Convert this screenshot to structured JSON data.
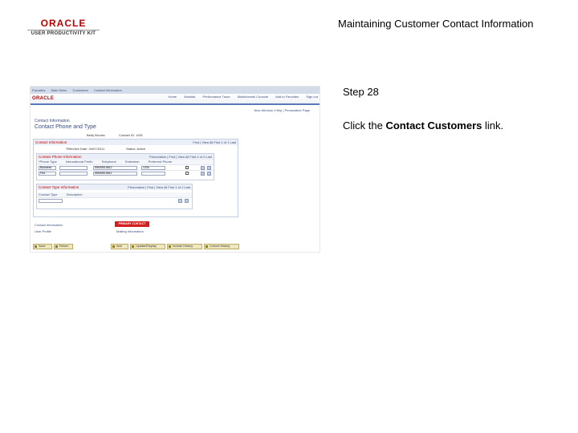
{
  "header": {
    "brand": "ORACLE",
    "brand_sub": "USER PRODUCTIVITY KIT",
    "title": "Maintaining Customer Contact Information"
  },
  "step": {
    "label": "Step 28",
    "instruction_prefix": "Click the ",
    "instruction_link": "Contact Customers",
    "instruction_suffix": " link."
  },
  "app": {
    "breadcrumbs": [
      "Favorites",
      "Main Menu",
      "Customers",
      "Contact Information"
    ],
    "brand": "ORACLE",
    "top_links": [
      "Home",
      "Worklist",
      "Performance Trace",
      "Multichannel Console",
      "Add to Favorites",
      "Sign out"
    ],
    "new_window": "New Window | Help | Personalize Page",
    "page_subtitle": "Contact Information",
    "page_title": "Contact Phone and Type",
    "name_field": "Betty Brooks",
    "contact_id": "Contact ID: 1451",
    "effective_date": "*Effective Date: 04/07/2011",
    "status": "Status: Active",
    "contact_info_header": "Contact Information",
    "contact_info_nav": "Find | View All   First  1 of 1  Last",
    "phone_header": "Contact Phone Information",
    "phone_nav": "Personalize | Find | View All   First  1 of 2  Last",
    "phone_cols": [
      "*Phone Type",
      "International Prefix",
      "Telephone",
      "Extension",
      "Preferred Phone"
    ],
    "phone_rows": [
      {
        "type": "Business",
        "number": "555/555-5612",
        "ext": "1234"
      },
      {
        "type": "FAX",
        "number": "555/555-5611",
        "ext": ""
      }
    ],
    "type_header": "Contact Type Information",
    "type_nav": "Personalize | Find | View All   First  1 of 1  Last",
    "type_cols": [
      "Contact Type",
      "Description"
    ],
    "red_button": "PRIMARY CONTACT",
    "links": [
      "Contact Information",
      "User Profile",
      "Mailing Information"
    ],
    "bottom_buttons": [
      "Save",
      "Return",
      "Add",
      "Update/Display",
      "Include History",
      "Correct History"
    ]
  }
}
